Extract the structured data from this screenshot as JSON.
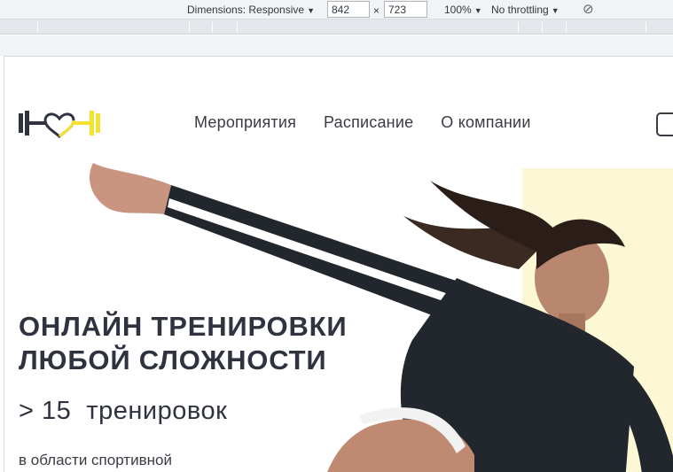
{
  "devtools": {
    "dimensions_label": "Dimensions: Responsive",
    "width_value": "842",
    "times_sign": "×",
    "height_value": "723",
    "zoom_label": "100%",
    "throttling_label": "No throttling",
    "dropdown_arrow": "▼",
    "rotate_icon": "⊘"
  },
  "site": {
    "nav": {
      "items": [
        "Мероприятия",
        "Расписание",
        "О компании"
      ]
    },
    "hero": {
      "title_line1": "ОНЛАЙН ТРЕНИРОВКИ",
      "title_line2": "ЛЮБОЙ СЛОЖНОСТИ",
      "count_text": "> 15  тренировок",
      "description": "в области спортивной"
    },
    "colors": {
      "accent_yellow": "#f5e22e",
      "dark": "#2f3340",
      "hero_background": "#fcf7d4"
    },
    "icons": {
      "logo": "dumbbell-heart-icon"
    }
  }
}
